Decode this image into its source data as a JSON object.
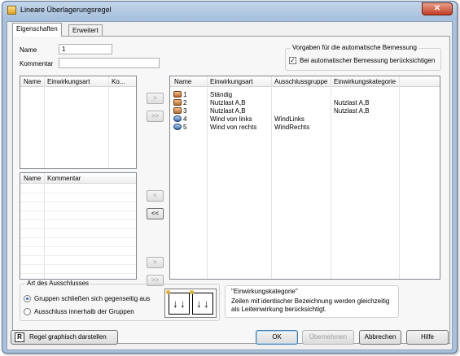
{
  "window": {
    "title": "Lineare Überlagerungsregel",
    "close_glyph": "✕"
  },
  "tabs": [
    {
      "label": "Eigenschaften",
      "active": true
    },
    {
      "label": "Erweitert",
      "active": false
    }
  ],
  "form": {
    "name_label": "Name",
    "name_value": "1",
    "kommentar_label": "Kommentar",
    "kommentar_value": ""
  },
  "bemessung": {
    "group_title": "Vorgaben für die automatische Bemessung",
    "checkbox_label": "Bei automatischer Bemessung berücksichtigen",
    "checked": true,
    "check_glyph": "✓"
  },
  "left_top_list": {
    "columns": [
      "Name",
      "Einwirkungsart",
      "Ko..."
    ]
  },
  "left_bottom_list": {
    "columns": [
      "Name",
      "Kommentar"
    ]
  },
  "transfer_buttons": {
    "top_add": ">",
    "top_add_all": ">>",
    "mid_remove": "<",
    "mid_remove_all": "<<",
    "bottom_add": ">",
    "bottom_add_all": ">>"
  },
  "main_list": {
    "columns": [
      "Name",
      "Einwirkungsart",
      "Ausschlussgruppe",
      "Einwirkungskategorie"
    ],
    "rows": [
      {
        "icon": "load-icon",
        "name": "1",
        "art": "Ständig",
        "gruppe": "",
        "kategorie": ""
      },
      {
        "icon": "load-icon",
        "name": "2",
        "art": "Nutzlast A,B",
        "gruppe": "",
        "kategorie": "Nutzlast A,B"
      },
      {
        "icon": "load-icon",
        "name": "3",
        "art": "Nutzlast A,B",
        "gruppe": "",
        "kategorie": "Nutzlast A,B"
      },
      {
        "icon": "wind-icon",
        "name": "4",
        "art": "Wind von links",
        "gruppe": "WindLinks",
        "kategorie": ""
      },
      {
        "icon": "wind-icon",
        "name": "5",
        "art": "Wind von rechts",
        "gruppe": "WindRechts",
        "kategorie": ""
      }
    ]
  },
  "ausschluss": {
    "group_title": "Art des Ausschlusses",
    "option1": "Gruppen schließen sich gegenseitig aus",
    "option2": "Ausschluss innerhalb der Gruppen",
    "selected": 1,
    "diagram_arrows": [
      "↓",
      "↓",
      "↓",
      "↓"
    ]
  },
  "hint": {
    "title": "\"Einwirkungskategorie\"",
    "text_line1": "Zeilen mit identischer Bezeichnung werden gleichzeitig",
    "text_line2": "als Leiteinwirkung berücksichtigt."
  },
  "footer": {
    "graph_icon_glyph": "R",
    "graph_button": "Regel graphisch darstellen",
    "ok": "OK",
    "apply": "Übernehmen",
    "cancel": "Abbrechen",
    "help": "Hilfe"
  }
}
